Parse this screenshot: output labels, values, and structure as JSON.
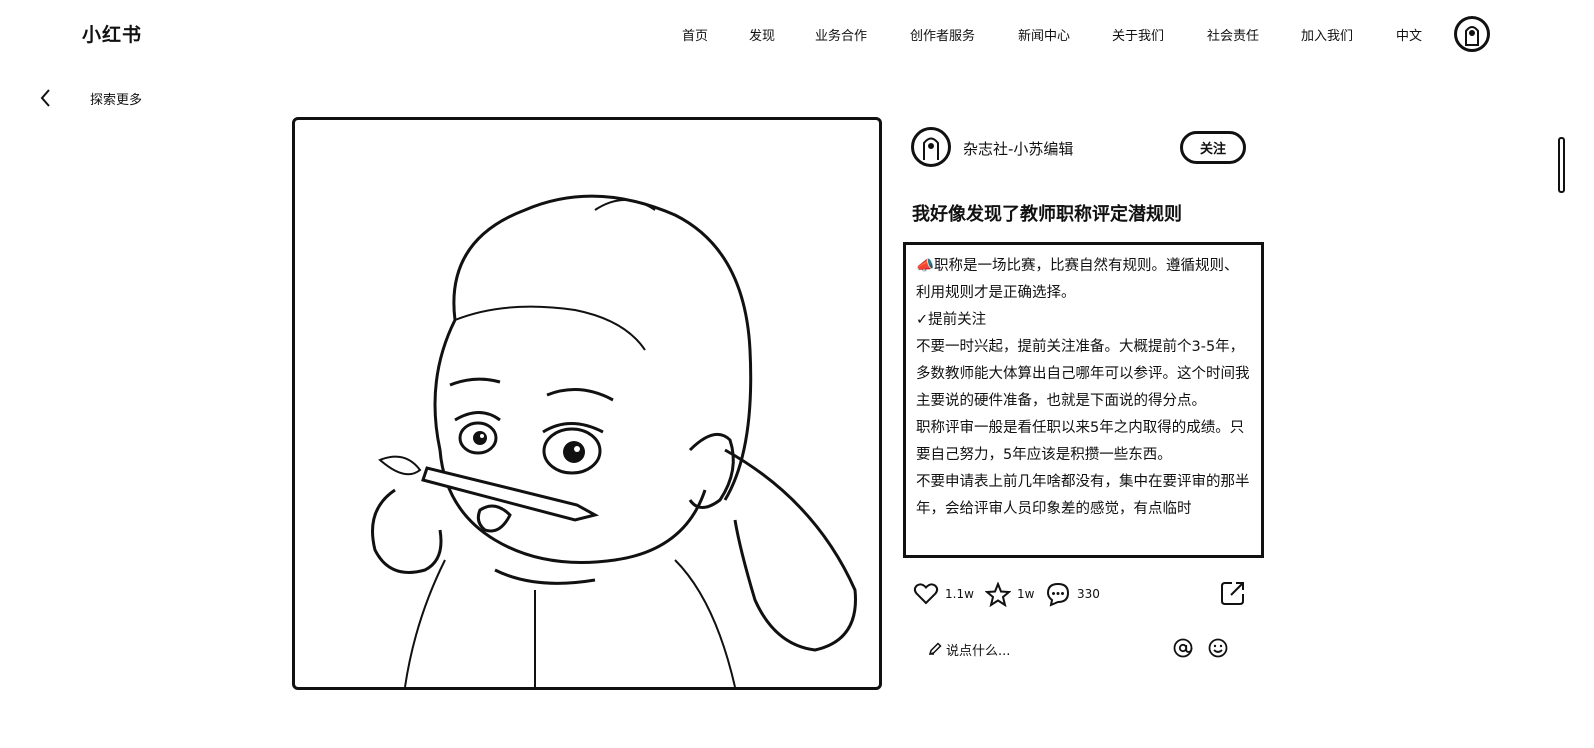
{
  "header": {
    "logo": "小红书",
    "nav": [
      {
        "label": "首页"
      },
      {
        "label": "发现"
      },
      {
        "label": "业务合作"
      },
      {
        "label": "创作者服务"
      },
      {
        "label": "新闻中心"
      },
      {
        "label": "关于我们"
      },
      {
        "label": "社会责任"
      },
      {
        "label": "加入我们"
      },
      {
        "label": "中文"
      }
    ]
  },
  "subnav": {
    "back_icon": "chevron-left-icon",
    "explore_label": "探索更多"
  },
  "note": {
    "author": "杂志社-小苏编辑",
    "follow_label": "关注",
    "title": "我好像发现了教师职称评定潜规则",
    "body": [
      "📣职称是一场比赛，比赛自然有规则。遵循规则、利用规则才是正确选择。",
      "✓提前关注",
      "不要一时兴起，提前关注准备。大概提前个3-5年，多数教师能大体算出自己哪年可以参评。这个时间我主要说的硬件准备，也就是下面说的得分点。",
      "职称评审一般是看任职以来5年之内取得的成绩。只要自己努力，5年应该是积攒一些东西。",
      "不要申请表上前几年啥都没有，集中在要评审的那半年，会给评审人员印象差的感觉，有点临时"
    ],
    "stats": {
      "likes": "1.1w",
      "collects": "1w",
      "comments": "330"
    },
    "comment_placeholder": "说点什么..."
  },
  "icons": {
    "like": "heart-icon",
    "collect": "star-icon",
    "comment": "chat-bubble-icon",
    "share": "share-icon",
    "mention": "at-icon",
    "emoji": "smiley-icon",
    "edit": "pencil-icon"
  }
}
